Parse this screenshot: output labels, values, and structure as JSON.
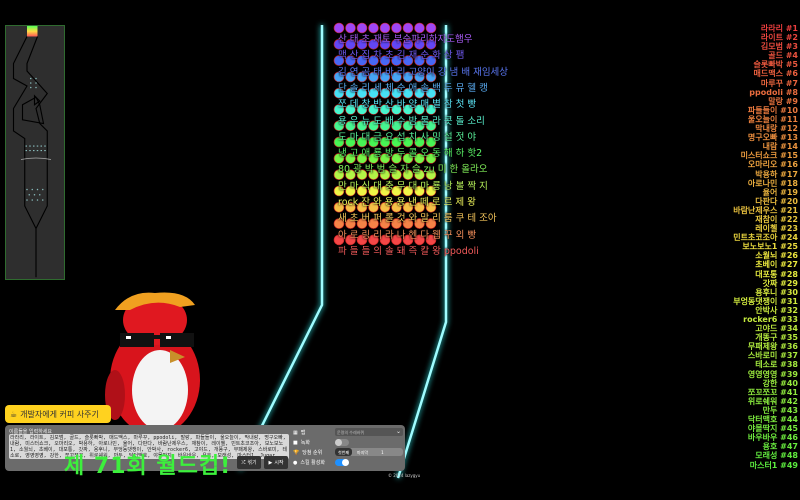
{
  "colors": {
    "accent": "#ffd21f",
    "title": "#3cf03c",
    "neon": "#8ffcff",
    "panel": "#6b6b6b"
  },
  "marble_labels": [
    "산 태 초 재토 부순파리하자도햄우",
    "맥 산 집 차 초 김 재 순 화 상 팸",
    "김 연 곰 태 바 리 고양이 강 냄 배 재임세상",
    "단 솔 리 세 체 순 애 솔 백 두 뮤 헬 캥",
    "쪼 데 창 반 산 바 양 매 별 참 첫 빵",
    "용 우 뉴 도 배 수 밤 물 라 콧 돌 소리",
    "도 마 대 금 요 섭 치 사 밍 설 젓 야",
    "냉 고 애 룡 방 두 콜 오 동 해 하 핫2",
    "80 광 박 범 슬 자 슬 zu 미 한 올라오",
    "만 마 식 대 충 무 대 마 룡 낭 볼 짝 지",
    "rock 잔 와 용 용 낸 떼 로 르 제 왕",
    "새 초 버 퍼 롤 것 와 말 리 룸 쿠 테 조아",
    "아 로 링 리 라 나 헨 다 웹 꾸 외 빵",
    "파 들 들 의 솔 돼 즉 칼 왕 ppodoli"
  ],
  "ranking": [
    "라라리",
    "라이트",
    "김모범",
    "골드",
    "슬롯빠박",
    "매드맥스",
    "마루꾸",
    "ppodoli",
    "말랑",
    "파들들이",
    "울오늘이",
    "막내랑",
    "명구오빠",
    "내람",
    "미스터쇼크",
    "오마리오",
    "박용하",
    "아로나민",
    "율어",
    "다판다",
    "바람난제우스",
    "재참이",
    "레이첼",
    "민트초코조아",
    "보노보노1",
    "소월뇌",
    "초베이",
    "대포통",
    "갓짜",
    "용후니",
    "부엉동댓쟁이",
    "안박사",
    "rocker6",
    "고야드",
    "개똥구",
    "무패제왕",
    "스바로미",
    "테소로",
    "영영영영",
    "강한",
    "쪼꼬쪼꼬",
    "위로쉐워",
    "만두",
    "닥터맥호",
    "야몰딱지",
    "바우바우",
    "용호",
    "모래성",
    "마스터1"
  ],
  "coffee_button": "개발자에게 커피 사주기",
  "panel": {
    "names_label": "이름들을 입력하세요",
    "names_value": "라라리, 라이트, 김모범, 골드, 슬롯빠박, 매드맥스, 마루꾸, ppodoli, 말랑, 파들들이, 울오늘이, 막내랑, 명구오빠, 내람, 미스터쇼크, 오마리오, 박용하, 아로나민, 율어, 다판다, 바람난제우스, 재참이, 레이첼, 민트초코조아, 보노보노1, 소월뇌, 초베이, 대포통, 갓짜, 용후니, 부엉동댓쟁이, 안박사, rocker6, 고야드, 개똥구, 무패제왕, 스바로미, 테소로, 영영영영, 강한, 쪼꼬쪼꼬, 위로쉐워, 만두, 닥터맥호, 야몰딱지, 바우바우, 용호, 모래성, 마스터1, Jugar",
    "shuffle_label": "섞기",
    "start_label": "시작",
    "map_label": "맵",
    "map_value": "운명의 수레바퀴",
    "record_label": "녹화",
    "record_on": false,
    "winner_label": "당첨 순위",
    "winner_first": "첫번째",
    "winner_last": "마지막",
    "winner_rank": "1",
    "skill_label": "스킬 활성화",
    "skill_on": true,
    "copyright": "© 2024 lazygyu"
  },
  "title": "제 71회 월드컵!"
}
